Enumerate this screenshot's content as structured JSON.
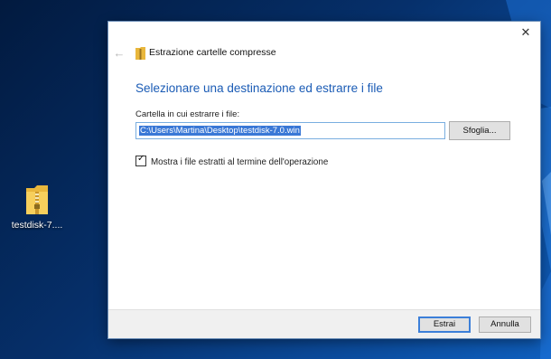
{
  "desktop": {
    "icon_label": "testdisk-7...."
  },
  "dialog": {
    "title": "Estrazione cartelle compresse",
    "heading": "Selezionare una destinazione ed estrarre i file",
    "folder_label": "Cartella in cui estrarre i file:",
    "folder_value": "C:\\Users\\Martina\\Desktop\\testdisk-7.0.win",
    "browse_label": "Sfoglia...",
    "checkbox_label": "Mostra i file estratti al termine dell'operazione",
    "checkbox_checked": true,
    "extract_label": "Estrai",
    "cancel_label": "Annulla"
  },
  "icons": {
    "close": "close-icon",
    "back": "back-arrow-icon",
    "title": "zip-folder-icon",
    "desktop": "zip-folder-icon"
  },
  "colors": {
    "heading": "#1a5bb5",
    "selection": "#3a78d6",
    "primary_border": "#3c7fd9"
  }
}
